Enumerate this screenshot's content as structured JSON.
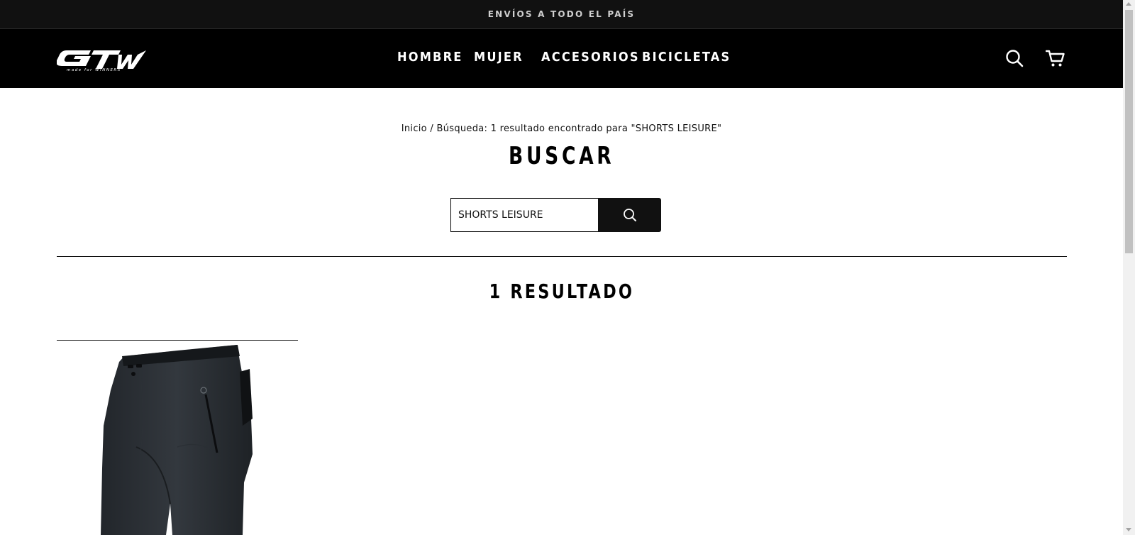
{
  "announcement": {
    "text": "ENVÍOS A TODO EL PAÍS"
  },
  "header": {
    "logo_alt": "GW made for WINNERS",
    "nav": [
      {
        "label": "HOMBRE"
      },
      {
        "label": "MUJER"
      },
      {
        "label": "ACCESORIOS"
      },
      {
        "label": "BICICLETAS"
      }
    ],
    "icons": [
      "search-icon",
      "cart-icon"
    ]
  },
  "breadcrumb": {
    "home": "Inicio",
    "separator": "/",
    "current": "Búsqueda: 1 resultado encontrado para \"SHORTS LEISURE\""
  },
  "page_title": "BUSCAR",
  "search": {
    "value": "SHORTS LEISURE",
    "button_icon": "search-icon"
  },
  "results": {
    "title": "1 RESULTADO",
    "products": [
      {
        "image": "shorts-product-image"
      }
    ]
  },
  "colors": {
    "announcement_bg": "#111111",
    "header_bg": "#000000",
    "button_bg": "#111111",
    "text": "#111111"
  }
}
